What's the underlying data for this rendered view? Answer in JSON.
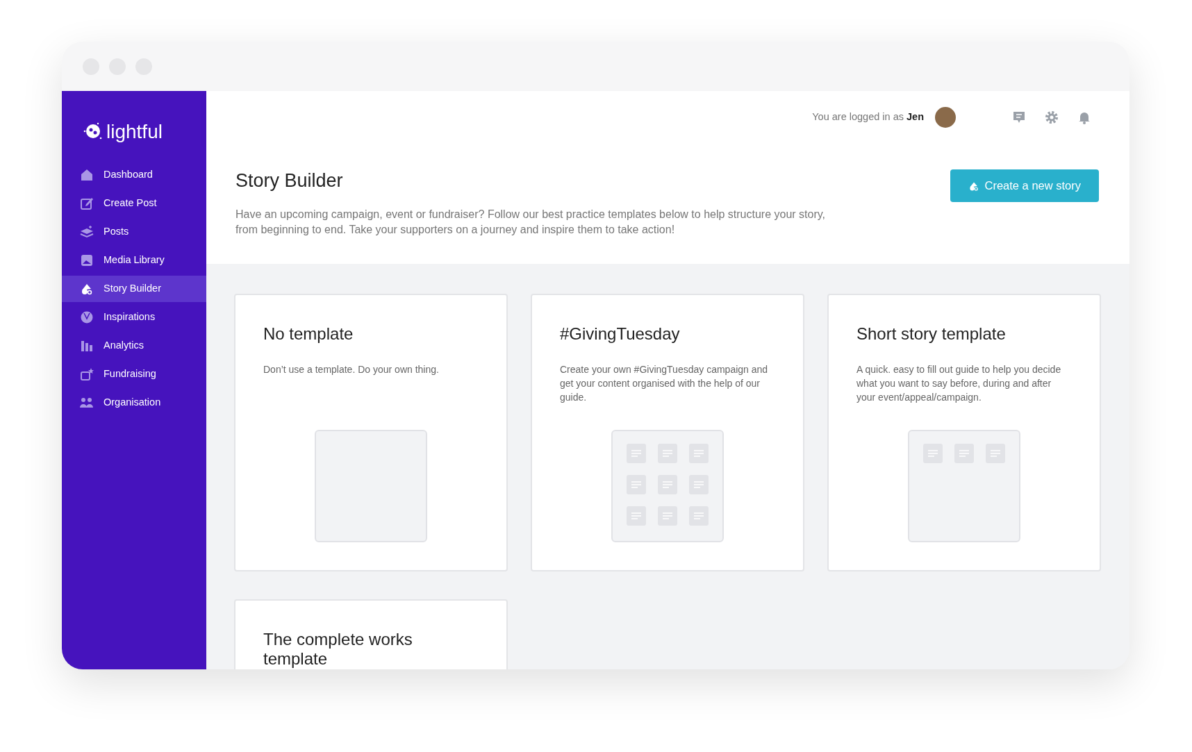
{
  "sidebar": {
    "logo": "lightful",
    "items": [
      {
        "label": "Dashboard",
        "selected": false
      },
      {
        "label": "Create Post",
        "selected": false
      },
      {
        "label": "Posts",
        "selected": false
      },
      {
        "label": "Media Library",
        "selected": false
      },
      {
        "label": "Story Builder",
        "selected": true
      },
      {
        "label": "Inspirations",
        "selected": false
      },
      {
        "label": "Analytics",
        "selected": false
      },
      {
        "label": "Fundraising",
        "selected": false
      },
      {
        "label": "Organisation",
        "selected": false
      }
    ]
  },
  "header": {
    "login_text": "You are logged in as **Jen**"
  },
  "page": {
    "title": "Story Builder",
    "description": "Have an upcoming campaign, event or fundraiser? Follow our best practice templates below to help structure your story, from beginning to end. Take your supporters on a journey and inspire them to take action!",
    "button": "Create a new story"
  },
  "templates": [
    {
      "title": "No template",
      "description": "Don’t use a template. Do your own thing.",
      "kind": "empty"
    },
    {
      "title": "#GivingTuesday",
      "description": "Create your own #GivingTuesday campaign and get your content organised with the help of our guide.",
      "kind": "full"
    },
    {
      "title": "Short story template",
      "description": "A quick. easy to fill out guide to help you decide what you want to say before, during and after your event/appeal/campaign.",
      "kind": "short"
    },
    {
      "title": "The complete works template"
    }
  ]
}
